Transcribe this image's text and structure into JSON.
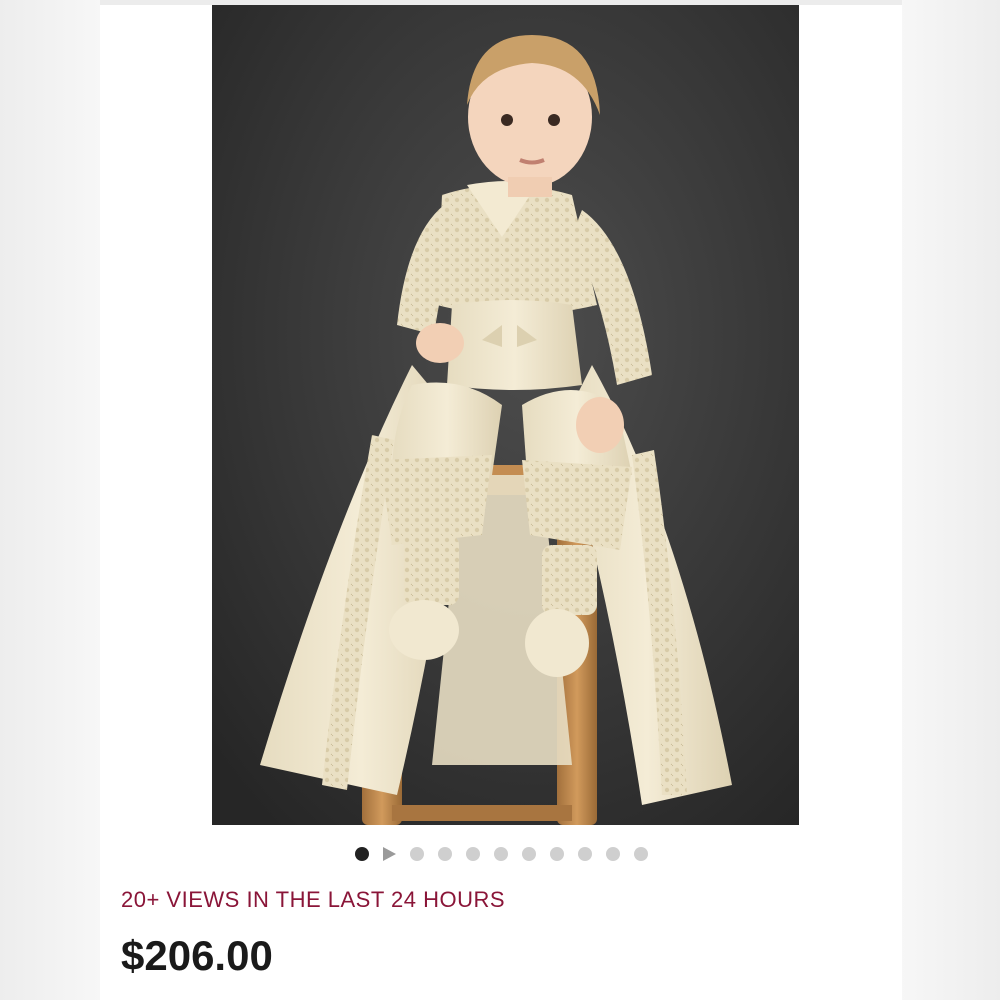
{
  "listing": {
    "views_text": "20+ VIEWS IN THE LAST 24 HOURS",
    "price": "$206.00"
  },
  "actions": {
    "share_icon": "share-upload-icon",
    "favorite_icon": "heart-outline-icon"
  },
  "gallery": {
    "total_items": 11,
    "active_index": 0,
    "video_index": 1,
    "image_description_icon": "photo"
  },
  "colors": {
    "accent": "#8a1538",
    "price_text": "#1a1a1a",
    "dot_active": "#222222",
    "dot_inactive": "#cfcfcf",
    "photo_background": "#3a3a3a",
    "garment": "#efe6cc"
  }
}
